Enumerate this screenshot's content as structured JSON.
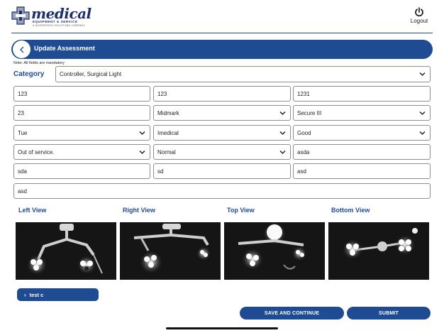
{
  "brand": {
    "name": "medical",
    "tagline": "EQUIPMENT & SERVICE",
    "subtag": "A DIVERSIFIED SOLUTIONS COMPANY",
    "color": "#1f2f6b"
  },
  "header": {
    "logout_label": "Logout",
    "logout_icon": "power-icon"
  },
  "titlebar": {
    "title": "Update Assessment",
    "back_icon": "chevron-left-icon",
    "color": "#1f4b93"
  },
  "form": {
    "note": "Note: All fields are mandatory",
    "category_label": "Category",
    "category_value": "Controller, Surgical Light",
    "row1": [
      "123",
      "123",
      "1231"
    ],
    "row2": {
      "f1": "23",
      "f2": "Midmark",
      "f3": "Secure III"
    },
    "row3": {
      "f1": "Tue",
      "f2": "Imedical",
      "f3": "Good"
    },
    "row4": {
      "f1": "Out of service.",
      "f2": "Normal",
      "f3": "asda"
    },
    "row5": [
      "sda",
      "sd",
      "asd"
    ],
    "row6": "asd"
  },
  "views": {
    "left": "Left View",
    "right": "Right View",
    "top": "Top View",
    "bottom": "Bottom View"
  },
  "section": {
    "label": "test c"
  },
  "actions": {
    "save_continue": "SAVE AND CONTINUE",
    "submit": "SUBMIT"
  }
}
